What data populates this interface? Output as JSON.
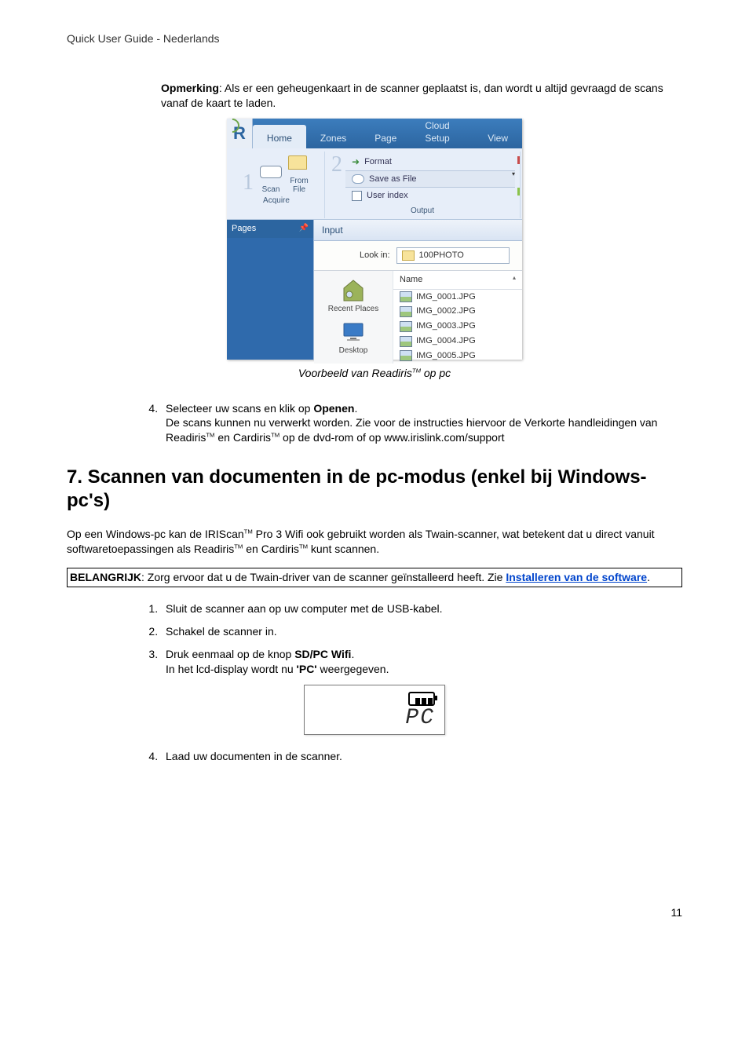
{
  "header": "Quick User Guide - Nederlands",
  "intro": {
    "bold": "Opmerking",
    "rest": ": Als er een geheugenkaart in de scanner geplaatst is, dan wordt u altijd gevraagd de scans vanaf de kaart te laden."
  },
  "ribbon": {
    "tabs": [
      "Home",
      "Zones",
      "Page",
      "Cloud Setup",
      "View"
    ],
    "acquire": {
      "scan": "Scan",
      "from_file": "From\nFile",
      "group": "Acquire"
    },
    "output": {
      "format": "Format",
      "save_as_file": "Save as File",
      "user_index": "User index",
      "group": "Output"
    },
    "pages": {
      "title": "Pages"
    },
    "input": {
      "title": "Input",
      "look_in_label": "Look in:",
      "look_in_value": "100PHOTO",
      "places": {
        "recent": "Recent Places",
        "desktop": "Desktop"
      },
      "col_name": "Name",
      "files": [
        "IMG_0001.JPG",
        "IMG_0002.JPG",
        "IMG_0003.JPG",
        "IMG_0004.JPG",
        "IMG_0005.JPG"
      ]
    }
  },
  "caption": {
    "pre": "Voorbeeld van Readiris",
    "post": " op pc"
  },
  "step4": {
    "line1a": "Selecteer uw scans en klik op ",
    "line1b": "Openen",
    "line1c": ".",
    "line2a": "De scans kunnen nu verwerkt worden. Zie voor de instructies hiervoor de Verkorte handleidingen van Readiris",
    "line2b": " en Cardiris",
    "line2c": " op de dvd-rom of op www.irislink.com/support"
  },
  "section_title": "7. Scannen van documenten in de pc-modus (enkel bij Windows-pc's)",
  "para1": {
    "a": "Op een Windows-pc kan de IRIScan",
    "b": " Pro 3 Wifi ook gebruikt worden als Twain-scanner, wat betekent dat u direct vanuit softwaretoepassingen als Readiris",
    "c": " en Cardiris",
    "d": " kunt scannen."
  },
  "box": {
    "bold": "BELANGRIJK",
    "a": ": Zorg ervoor dat u de Twain-driver van de scanner geïnstalleerd heeft. Zie ",
    "link": "Installeren van de software",
    "b": "."
  },
  "steps": {
    "s1": "Sluit de scanner aan op uw computer met de USB-kabel.",
    "s2": "Schakel de scanner in.",
    "s3a": "Druk eenmaal op de knop ",
    "s3bold": "SD/PC Wifi",
    "s3b": ".",
    "s3c_a": "In het lcd-display wordt nu ",
    "s3c_bold": "'PC'",
    "s3c_b": " weergegeven.",
    "s4": "Laad uw documenten in de scanner."
  },
  "lcd": {
    "text": "PC"
  },
  "pagenum": "11"
}
